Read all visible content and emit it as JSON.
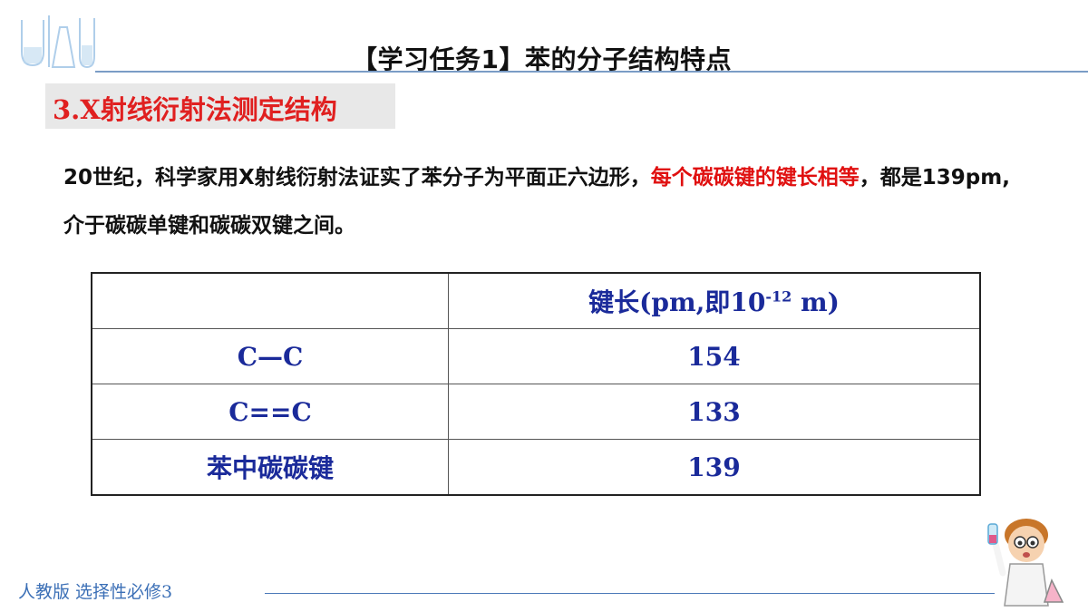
{
  "header": {
    "title": "【学习任务1】苯的分子结构特点"
  },
  "section": {
    "label": "3.X射线衍射法测定结构"
  },
  "paragraph": {
    "part1": "20世纪，科学家用X射线衍射法证实了苯分子为平面正六边形，",
    "highlight": "每个碳碳键的键长相等",
    "part2": "，都是139pm,介于碳碳单键和碳碳双键之间。"
  },
  "table": {
    "header": {
      "col0": "",
      "col1_prefix": "键长(pm,即10",
      "col1_exp": "-12",
      "col1_suffix": " m)"
    },
    "rows": [
      {
        "label": "C—C",
        "value": "154"
      },
      {
        "label": "C==C",
        "value": "133"
      },
      {
        "label": "苯中碳碳键",
        "value": "139"
      }
    ]
  },
  "footer": {
    "text": "人教版 选择性必修3"
  },
  "colors": {
    "accent_red": "#e01010",
    "table_text": "#1a2a9a",
    "footer_blue": "#3b6fb6"
  },
  "icons": [
    "lab-glassware-icon",
    "scientist-kid-icon"
  ]
}
